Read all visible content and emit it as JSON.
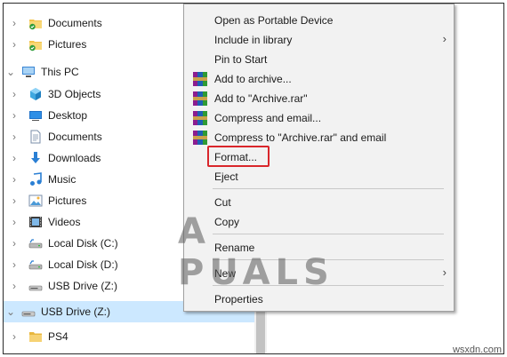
{
  "tree": [
    {
      "label": "Documents",
      "icon": "documents-sync-folder-icon",
      "chevron": "›",
      "indent": 1
    },
    {
      "label": "Pictures",
      "icon": "pictures-sync-folder-icon",
      "chevron": "›",
      "indent": 1
    },
    {
      "label": "This PC",
      "icon": "this-pc-icon",
      "chevron": "⌄",
      "indent": 0
    },
    {
      "label": "3D Objects",
      "icon": "3d-objects-icon",
      "chevron": "›",
      "indent": 1
    },
    {
      "label": "Desktop",
      "icon": "desktop-icon",
      "chevron": "›",
      "indent": 1
    },
    {
      "label": "Documents",
      "icon": "documents-icon",
      "chevron": "›",
      "indent": 1
    },
    {
      "label": "Downloads",
      "icon": "downloads-icon",
      "chevron": "›",
      "indent": 1
    },
    {
      "label": "Music",
      "icon": "music-icon",
      "chevron": "›",
      "indent": 1
    },
    {
      "label": "Pictures",
      "icon": "pictures-icon",
      "chevron": "›",
      "indent": 1
    },
    {
      "label": "Videos",
      "icon": "videos-icon",
      "chevron": "›",
      "indent": 1
    },
    {
      "label": "Local Disk (C:)",
      "icon": "local-disk-icon",
      "chevron": "›",
      "indent": 1
    },
    {
      "label": "Local Disk (D:)",
      "icon": "local-disk-icon",
      "chevron": "›",
      "indent": 1
    },
    {
      "label": "USB Drive (Z:)",
      "icon": "usb-drive-icon",
      "chevron": "›",
      "indent": 1
    },
    {
      "label": "USB Drive (Z:)",
      "icon": "usb-drive-icon",
      "chevron": "⌄",
      "indent": 0,
      "selected": true
    },
    {
      "label": "PS4",
      "icon": "folder-icon",
      "chevron": "›",
      "indent": 1
    }
  ],
  "menu": {
    "items": [
      {
        "label": "Open as Portable Device"
      },
      {
        "label": "Include in library",
        "submenu": "›"
      },
      {
        "label": "Pin to Start"
      },
      {
        "label": "Add to archive...",
        "icon": "winrar-icon"
      },
      {
        "label": "Add to \"Archive.rar\"",
        "icon": "winrar-icon"
      },
      {
        "label": "Compress and email...",
        "icon": "winrar-icon"
      },
      {
        "label": "Compress to \"Archive.rar\" and email",
        "icon": "winrar-icon"
      },
      {
        "label": "Format..."
      },
      {
        "label": "Eject"
      },
      {
        "label": "Cut"
      },
      {
        "label": "Copy"
      },
      {
        "label": "Rename"
      },
      {
        "label": "New",
        "submenu": "›"
      },
      {
        "label": "Properties"
      }
    ]
  },
  "watermark": "A PUALS",
  "corner_mark": "wsxdn.com",
  "colors": {
    "selection": "#cce8ff",
    "menu_bg": "#f2f2f2",
    "highlight_box": "#d9262b"
  }
}
